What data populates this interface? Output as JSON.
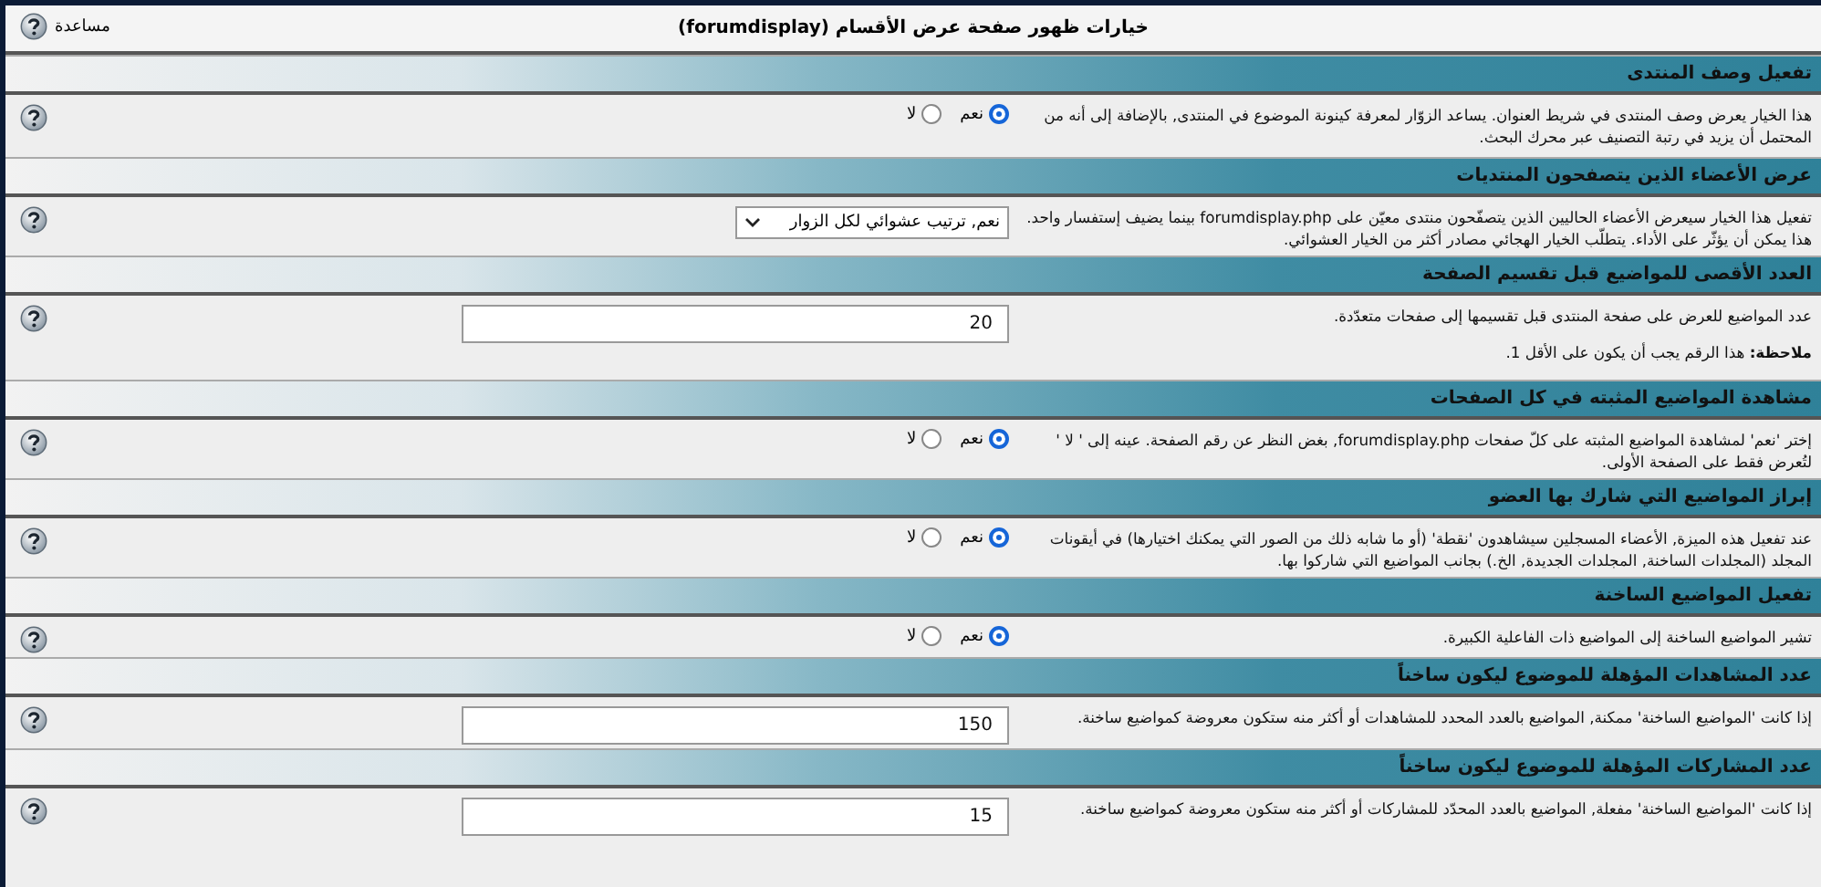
{
  "title": "خيارات ظهور صفحة عرض الأقسام (forumdisplay)",
  "help_link": "مساعدة",
  "settings": [
    {
      "kind": "radio",
      "heading": "تفعيل وصف المنتدى",
      "description": [
        "هذا الخيار يعرض وصف المنتدى في شريط العنوان. يساعد الزوّار لمعرفة كينونة الموضوع في المنتدى, بالإضافة إلى أنه من المحتمل أن يزيد في رتبة التصنيف عبر محرك البحث."
      ],
      "options": [
        {
          "label": "نعم",
          "selected": true
        },
        {
          "label": "لا",
          "selected": false
        }
      ]
    },
    {
      "kind": "select",
      "heading": "عرض الأعضاء الذين يتصفحون المنتديات",
      "description": [
        "تفعيل هذا الخيار سيعرض الأعضاء الحاليين الذين يتصفّحون منتدى معيّن على forumdisplay.php بينما يضيف إستفسار واحد. هذا يمكن أن يؤثّر على الأداء. يتطلّب الخيار الهجائي مصادر أكثر من الخيار العشوائي."
      ],
      "value": "نعم, ترتيب عشوائي لكل الزوار"
    },
    {
      "kind": "input",
      "heading": "العدد الأقصى للمواضيع قبل تقسيم الصفحة",
      "description": [
        "عدد المواضيع للعرض على صفحة المنتدى قبل تقسيمها إلى صفحات متعدّدة.",
        "**ملاحظة:** هذا الرقم يجب أن يكون على الأقل 1."
      ],
      "value": "20"
    },
    {
      "kind": "radio",
      "heading": "مشاهدة المواضيع المثبته في كل الصفحات",
      "description": [
        "إختر 'نعم' لمشاهدة المواضيع المثبته على كلّ صفحات forumdisplay.php, بغض النظر عن رقم الصفحة. عينه إلى ' لا ' لتُعرض فقط على الصفحة الأولى."
      ],
      "options": [
        {
          "label": "نعم",
          "selected": true
        },
        {
          "label": "لا",
          "selected": false
        }
      ]
    },
    {
      "kind": "radio",
      "heading": "إبراز المواضيع التي شارك بها العضو",
      "description": [
        "عند تفعيل هذه الميزة, الأعضاء المسجلين سيشاهدون 'نقطة' (أو ما شابه ذلك من الصور التي يمكنك اختيارها) في أيقونات المجلد (المجلدات الساخنة, المجلدات الجديدة, الخ.) بجانب المواضيع التي شاركوا بها."
      ],
      "options": [
        {
          "label": "نعم",
          "selected": true
        },
        {
          "label": "لا",
          "selected": false
        }
      ]
    },
    {
      "kind": "radio",
      "heading": "تفعيل المواضيع الساخنة",
      "description": [
        "تشير المواضيع الساخنة إلى المواضيع ذات الفاعلية الكبيرة."
      ],
      "options": [
        {
          "label": "نعم",
          "selected": true
        },
        {
          "label": "لا",
          "selected": false
        }
      ]
    },
    {
      "kind": "input",
      "heading": "عدد المشاهدات المؤهلة للموضوع ليكون ساخناً",
      "description": [
        "إذا كانت 'المواضيع الساخنة' ممكنة, المواضيع بالعدد المحدد للمشاهدات أو أكثر منه ستكون معروضة كمواضيع ساخنة."
      ],
      "value": "150"
    },
    {
      "kind": "input",
      "heading": "عدد المشاركات المؤهلة للموضوع ليكون ساخناً",
      "description": [
        "إذا كانت 'المواضيع الساخنة' مفعلة, المواضيع بالعدد المحدّد للمشاركات أو أكثر منه ستكون معروضة كمواضيع ساخنة."
      ],
      "value": "15"
    }
  ]
}
